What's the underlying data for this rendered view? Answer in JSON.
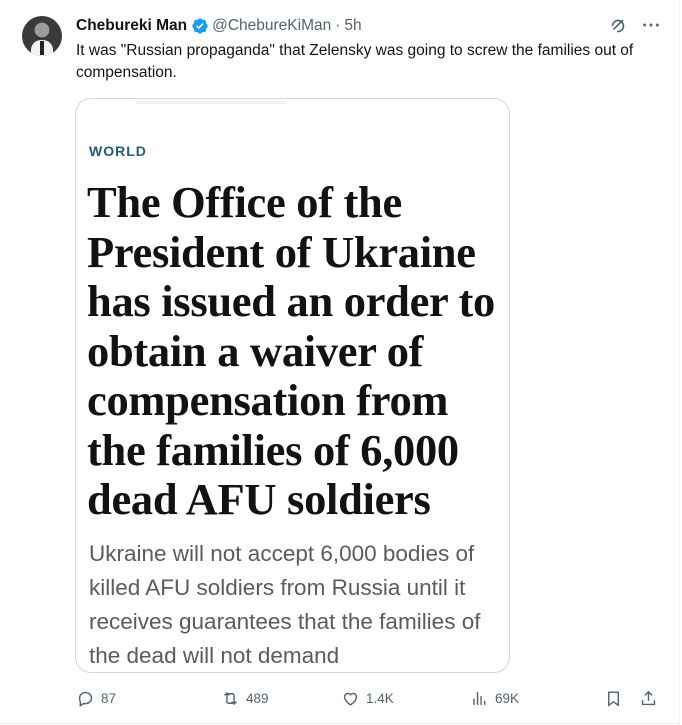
{
  "tweet": {
    "author_name": "Chebureki Man",
    "handle": "@ChebureKiMan",
    "separator": "·",
    "time": "5h",
    "text": "It was \"Russian propaganda\" that Zelensky was going to screw the families out of compensation."
  },
  "article": {
    "section": "WORLD",
    "headline": "The Office of the President of Ukraine has issued an order to obtain a waiver of compensation from the families of 6,000 dead AFU soldiers",
    "subhead": "Ukraine will not accept 6,000 bodies of killed AFU soldiers from Russia until it receives guarantees that the families of the dead will not demand"
  },
  "actions": {
    "replies": "87",
    "reposts": "489",
    "likes": "1.4K",
    "views": "69K"
  },
  "colors": {
    "verified": "#1d9bf0",
    "muted": "#536471",
    "section": "#245a7a"
  },
  "icons": [
    "verified-badge-icon",
    "grok-icon",
    "more-icon",
    "reply-icon",
    "repost-icon",
    "like-icon",
    "views-icon",
    "bookmark-icon",
    "share-icon"
  ]
}
